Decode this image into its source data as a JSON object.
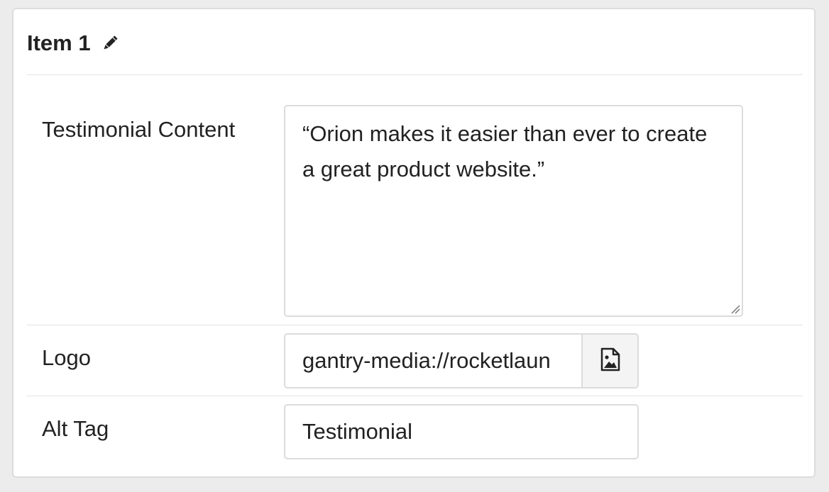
{
  "item": {
    "title": "Item 1",
    "edit_icon": "pencil-icon"
  },
  "fields": {
    "testimonial": {
      "label": "Testimonial Content",
      "value_line1": "“Orion makes it easier than ever to create",
      "value_line2": "a great product website.”"
    },
    "logo": {
      "label": "Logo",
      "value": "gantry-media://rocketlaun",
      "picker_icon": "image-file-icon"
    },
    "alt_tag": {
      "label": "Alt Tag",
      "value": "Testimonial"
    }
  }
}
